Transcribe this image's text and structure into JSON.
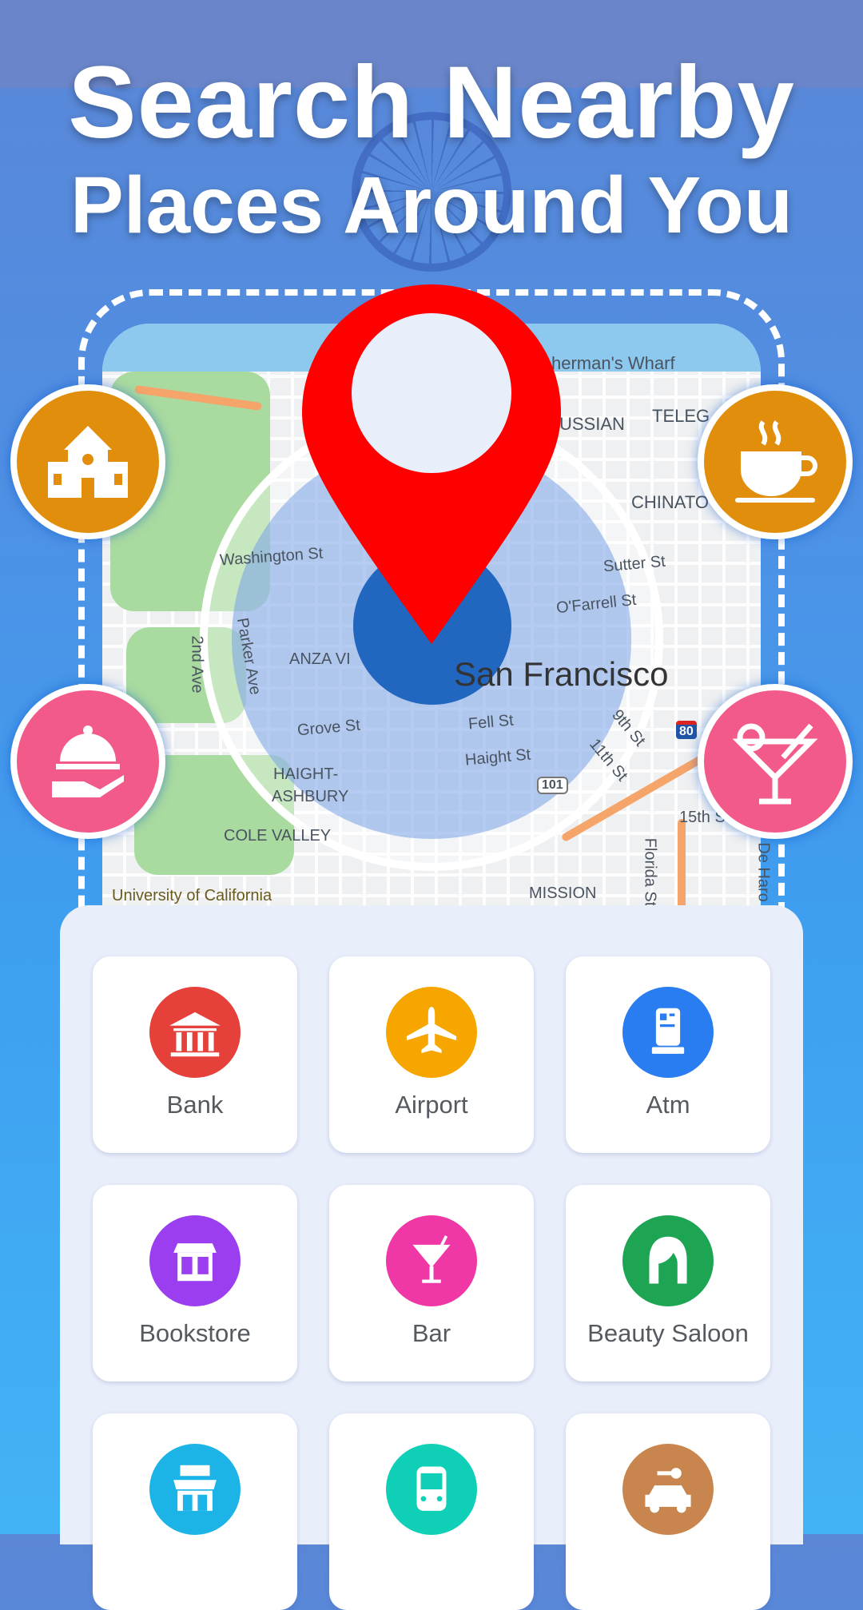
{
  "headline": {
    "line1": "Search Nearby",
    "line2": "Places Around You"
  },
  "map": {
    "city_label": "San Francisco",
    "labels": [
      "herman's Wharf",
      "TELEG",
      "USSIAN",
      "CHINATO",
      "Washington St",
      "Sutter St",
      "O'Farrell St",
      "Parker Ave",
      "2nd Ave",
      "ANZA VI",
      "Grove St",
      "Fell St",
      "Haight St",
      "9th St",
      "11th St",
      "HAIGHT-",
      "ASHBURY",
      "COLE VALLEY",
      "University of California",
      "MISSION",
      "Florida St",
      "De Haro",
      "15th St",
      "101",
      "80"
    ]
  },
  "colors": {
    "pin": "#ff0000",
    "location_dot": "#2166bf",
    "side_orange": "#e08e0b",
    "side_pink": "#f25a8a"
  },
  "side_icons": [
    {
      "icon": "building-icon",
      "color": "#e08e0b"
    },
    {
      "icon": "coffee-cup-icon",
      "color": "#e08e0b"
    },
    {
      "icon": "food-service-icon",
      "color": "#f25a8a"
    },
    {
      "icon": "cocktail-icon",
      "color": "#f25a8a"
    }
  ],
  "categories": [
    {
      "label": "Bank",
      "icon": "bank-icon",
      "color": "#e5403a"
    },
    {
      "label": "Airport",
      "icon": "airplane-icon",
      "color": "#f7a600"
    },
    {
      "label": "Atm",
      "icon": "atm-icon",
      "color": "#2a7df0"
    },
    {
      "label": "Bookstore",
      "icon": "bookstore-icon",
      "color": "#9b3ef0"
    },
    {
      "label": "Bar",
      "icon": "cocktail-icon",
      "color": "#ef38a6"
    },
    {
      "label": "Beauty Saloon",
      "icon": "woman-face-icon",
      "color": "#1ea553"
    },
    {
      "label": "",
      "icon": "cafe-icon",
      "color": "#1cb4e6"
    },
    {
      "label": "",
      "icon": "bus-icon",
      "color": "#10cfb7"
    },
    {
      "label": "",
      "icon": "car-rental-icon",
      "color": "#c8864e"
    }
  ]
}
